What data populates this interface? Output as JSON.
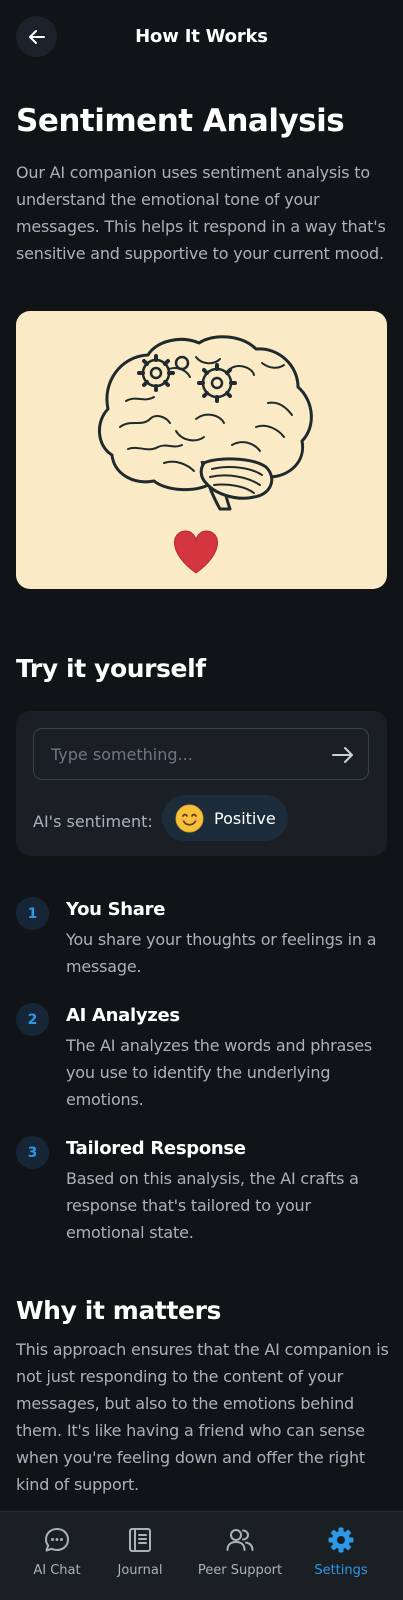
{
  "header": {
    "title": "How It Works"
  },
  "page_title": "Sentiment Analysis",
  "intro": "Our AI companion uses sentiment analysis to understand the emotional tone of your messages. This helps it respond in a way that's sensitive and supportive to your current mood.",
  "hero": {
    "icon": "brain-with-gears-and-heart-illustration"
  },
  "try_section": {
    "title": "Try it yourself",
    "input_placeholder": "Type something...",
    "sentiment_label": "AI's sentiment:",
    "sentiment_emoji": "😊",
    "sentiment_value": "Positive"
  },
  "steps": [
    {
      "num": "1",
      "title": "You Share",
      "desc": "You share your thoughts or feelings in a message."
    },
    {
      "num": "2",
      "title": "AI Analyzes",
      "desc": "The AI analyzes the words and phrases you use to identify the underlying emotions."
    },
    {
      "num": "3",
      "title": "Tailored Response",
      "desc": "Based on this analysis, the AI crafts a response that's tailored to your emotional state."
    }
  ],
  "why": {
    "title": "Why it matters",
    "text": "This approach ensures that the AI companion is not just responding to the content of your messages, but also to the emotions behind them. It's like having a friend who can sense when you're feeling down and offer the right kind of support."
  },
  "nav": {
    "items": [
      {
        "label": "AI Chat",
        "icon": "chat-bubble-icon"
      },
      {
        "label": "Journal",
        "icon": "journal-icon"
      },
      {
        "label": "Peer Support",
        "icon": "people-icon"
      },
      {
        "label": "Settings",
        "icon": "gear-icon"
      }
    ],
    "active": "Settings"
  },
  "colors": {
    "background": "#111417",
    "card": "#1a1f25",
    "accent": "#2e98e6",
    "muted_text": "#a9b2bb",
    "hero_background": "#fbeac6",
    "heart": "#d3363f"
  }
}
